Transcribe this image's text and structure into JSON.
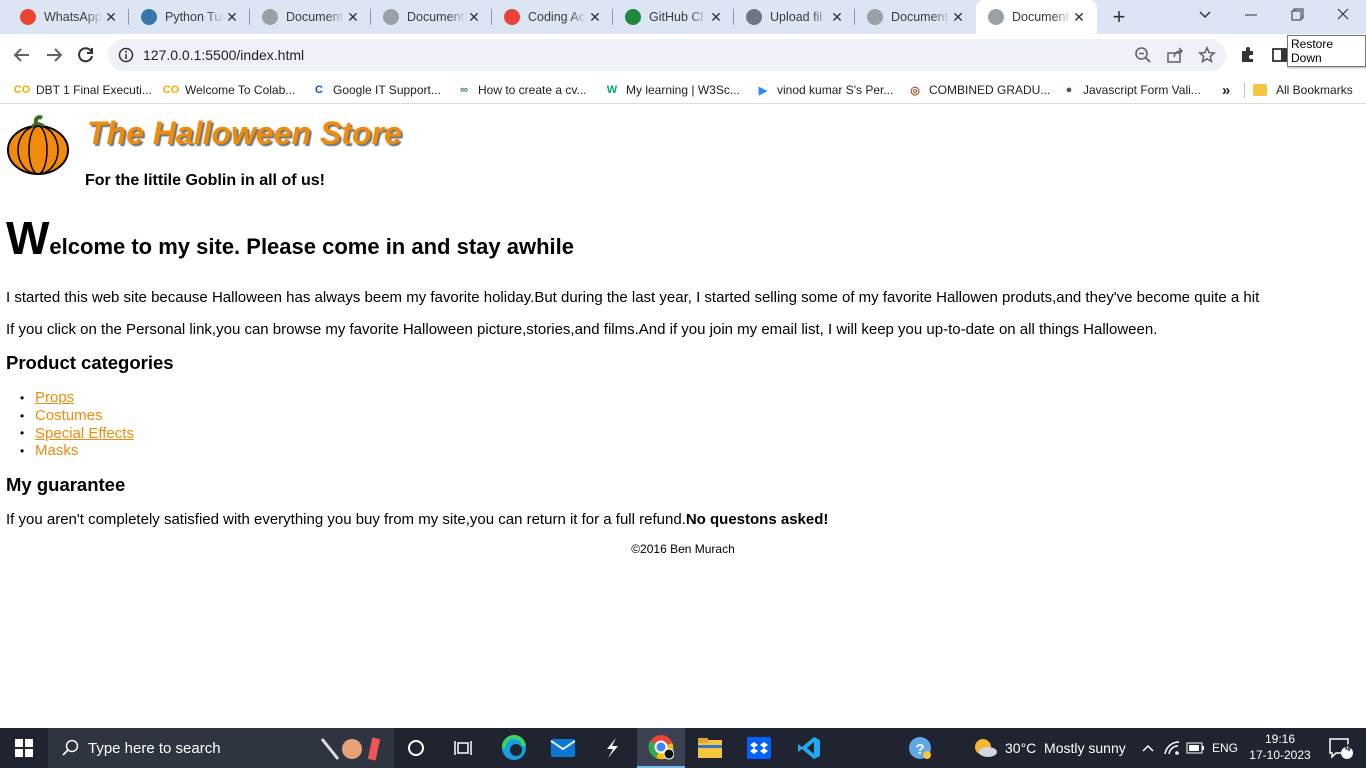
{
  "browser": {
    "tabs": [
      {
        "title": "WhatsApp",
        "icon": "whatsapp-icon",
        "color": "#e8442e"
      },
      {
        "title": "Python Tutorial",
        "icon": "python-icon",
        "color": "#3776ab"
      },
      {
        "title": "Document",
        "icon": "globe-icon",
        "color": "#9aa0a6"
      },
      {
        "title": "Document",
        "icon": "globe-icon",
        "color": "#9aa0a6"
      },
      {
        "title": "Coding Ac",
        "icon": "gmail-icon",
        "color": "#ea4335"
      },
      {
        "title": "GitHub Cl",
        "icon": "github-icon",
        "color": "#1f883d"
      },
      {
        "title": "Upload fil",
        "icon": "github-icon",
        "color": "#6e7681"
      },
      {
        "title": "Document",
        "icon": "globe-icon",
        "color": "#9aa0a6"
      },
      {
        "title": "Document",
        "icon": "globe-icon",
        "color": "#9aa0a6"
      }
    ],
    "active_tab_index": 8,
    "url": "127.0.0.1:5500/index.html",
    "tooltip": "Restore Down",
    "bookmarks": [
      {
        "label": "DBT 1 Final Executi...",
        "icon": "colab-icon",
        "glyph": "CO",
        "color": "#f9ab00"
      },
      {
        "label": "Welcome To Colab...",
        "icon": "colab-icon",
        "glyph": "CO",
        "color": "#f9ab00"
      },
      {
        "label": "Google IT Support...",
        "icon": "coursera-icon",
        "glyph": "C",
        "color": "#0056d2"
      },
      {
        "label": "How to create a cv...",
        "icon": "gfg-icon",
        "glyph": "∞",
        "color": "#2f8d46"
      },
      {
        "label": "My learning | W3Sc...",
        "icon": "w3schools-icon",
        "glyph": "W",
        "color": "#04aa6d"
      },
      {
        "label": "vinod kumar S's Per...",
        "icon": "zoom-icon",
        "glyph": "▶",
        "color": "#2d8cff"
      },
      {
        "label": "COMBINED GRADU...",
        "icon": "emblem-icon",
        "glyph": "◎",
        "color": "#a0522d"
      },
      {
        "label": "Javascript Form Vali...",
        "icon": "person-icon",
        "glyph": "●",
        "color": "#6b4f3a"
      }
    ],
    "more_bookmarks": "»",
    "all_bookmarks": "All Bookmarks"
  },
  "page": {
    "site_title": "The Halloween Store",
    "tagline": "For the littile Goblin in all of us!",
    "welcome_first_letter": "W",
    "welcome_rest": "elcome to my site. Please come in and stay awhile",
    "paragraph1": "I started this web site because Halloween has always beem my favorite holiday.But during the last year, I started selling some of my favorite Hallowen produts,and they've become quite a hit",
    "paragraph2": "If you click on the Personal link,you can browse my favorite Halloween picture,stories,and films.And if you join my email list, I will keep you up-to-date on all things Halloween.",
    "categories_heading": "Product categories",
    "categories": [
      "Props",
      "Costumes",
      "Special Effects",
      "Masks"
    ],
    "guarantee_heading": "My guarantee",
    "guarantee_text": "If you aren't completely satisfied with everything you buy from my site,you can return it for a full refund.",
    "guarantee_bold": "No questons asked!",
    "footer": "©2016 Ben Murach",
    "accent_color": "#ef8c0b"
  },
  "taskbar": {
    "search_placeholder": "Type here to search",
    "weather": "30°C  Mostly sunny",
    "language": "ENG",
    "time": "19:16",
    "date": "17-10-2023",
    "notification_count": "4"
  }
}
